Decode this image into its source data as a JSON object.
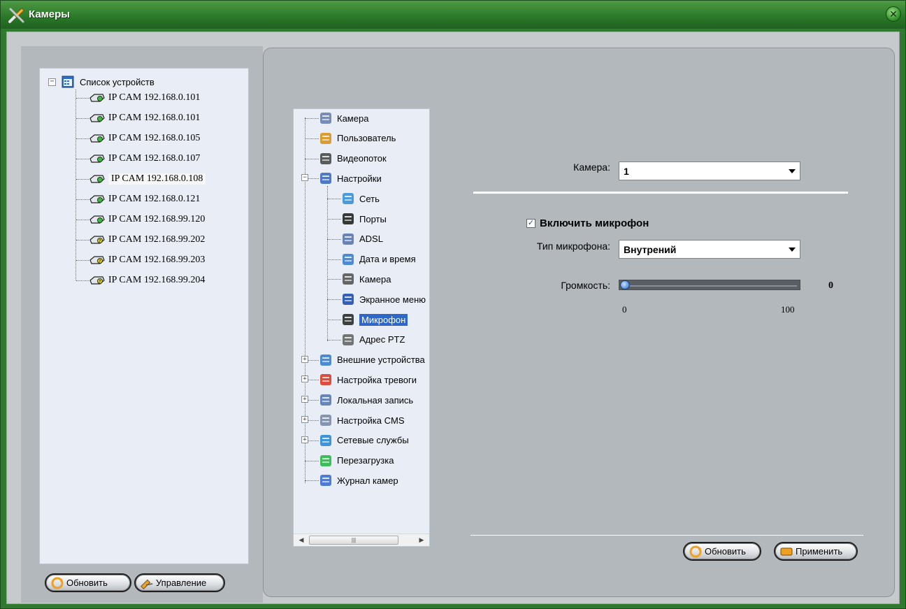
{
  "window": {
    "title": "Камеры",
    "close_icon": "close-icon"
  },
  "device_tree": {
    "root_label": "Список устройств",
    "items": [
      {
        "label": "IP CAM 192.168.0.101",
        "icon": "camera-online-icon"
      },
      {
        "label": "IP CAM 192.168.0.101",
        "icon": "camera-online-icon"
      },
      {
        "label": "IP CAM 192.168.0.105",
        "icon": "camera-online-icon"
      },
      {
        "label": "IP CAM 192.168.0.107",
        "icon": "camera-online-icon"
      },
      {
        "label": "IP CAM 192.168.0.108",
        "icon": "camera-online-icon"
      },
      {
        "label": "IP CAM 192.168.0.121",
        "icon": "camera-online-icon"
      },
      {
        "label": "IP CAM 192.168.99.120",
        "icon": "camera-online-icon"
      },
      {
        "label": "IP CAM 192.168.99.202",
        "icon": "camera-unknown-icon"
      },
      {
        "label": "IP CAM 192.168.99.203",
        "icon": "camera-unknown-icon"
      },
      {
        "label": "IP CAM 192.168.99.204",
        "icon": "camera-unknown-icon"
      }
    ],
    "selected_index": 4
  },
  "left_buttons": {
    "refresh": "Обновить",
    "manage": "Управление"
  },
  "settings_tree": {
    "items": [
      {
        "label": "Камера",
        "icon": "document-icon"
      },
      {
        "label": "Пользователь",
        "icon": "users-icon"
      },
      {
        "label": "Видеопоток",
        "icon": "stream-icon"
      },
      {
        "label": "Настройки",
        "icon": "tools-icon"
      },
      {
        "label": "Сеть",
        "icon": "network-icon"
      },
      {
        "label": "Порты",
        "icon": "port-icon"
      },
      {
        "label": "ADSL",
        "icon": "adsl-icon"
      },
      {
        "label": "Дата и время",
        "icon": "calendar-icon"
      },
      {
        "label": "Камера",
        "icon": "camera-icon"
      },
      {
        "label": "Экранное меню",
        "icon": "osd-icon"
      },
      {
        "label": "Микрофон",
        "icon": "microphone-icon"
      },
      {
        "label": "Адрес PTZ",
        "icon": "ptz-icon"
      },
      {
        "label": "Внешние устройства",
        "icon": "external-device-icon"
      },
      {
        "label": "Настройка тревоги",
        "icon": "alarm-icon"
      },
      {
        "label": "Локальная запись",
        "icon": "local-record-icon"
      },
      {
        "label": "Настройка CMS",
        "icon": "cms-icon"
      },
      {
        "label": "Сетевые службы",
        "icon": "network-services-icon"
      },
      {
        "label": "Перезагрузка",
        "icon": "reboot-icon"
      },
      {
        "label": "Журнал камер",
        "icon": "log-icon"
      }
    ],
    "selected": "Микрофон"
  },
  "form": {
    "camera_label": "Камера:",
    "camera_value": "1",
    "enable_mic_label": "Включить микрофон",
    "enable_mic_checked": true,
    "mic_type_label": "Тип микрофона:",
    "mic_type_value": "Внутрений",
    "volume_label": "Громкость:",
    "volume_value": "0",
    "volume_fraction": 0,
    "slider_min": "0",
    "slider_max": "100"
  },
  "right_buttons": {
    "refresh": "Обновить",
    "apply": "Применить"
  },
  "colors": {
    "title_green": "#2c7a2a",
    "selection_blue": "#2f67c8",
    "panel_gray": "#b3b8bd"
  }
}
